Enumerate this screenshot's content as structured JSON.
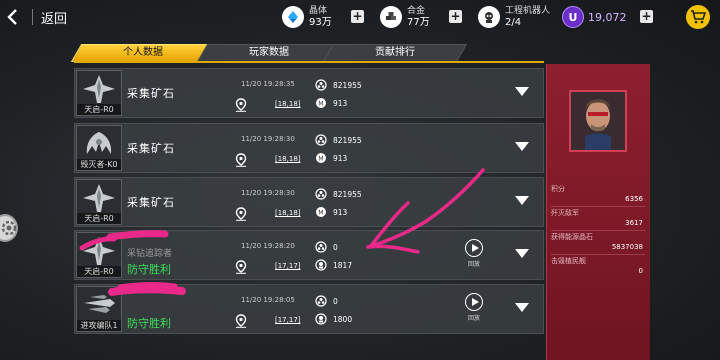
{
  "topbar": {
    "back_label": "返回",
    "crystal": {
      "name": "晶体",
      "value": "93万",
      "icon": "crystal-icon",
      "color": "#2aa8ff"
    },
    "alloy": {
      "name": "合金",
      "value": "77万",
      "icon": "alloy-icon"
    },
    "robots": {
      "name": "工程机器人",
      "value": "2/4",
      "icon": "robot-icon"
    },
    "premium": {
      "value": "19,072",
      "icon": "u-currency-icon",
      "color": "#a66cff"
    },
    "cart_icon": "shopping-cart-icon"
  },
  "tabs": [
    {
      "label": "个人数据",
      "active": true
    },
    {
      "label": "玩家数据",
      "active": false
    },
    {
      "label": "贡献排行",
      "active": false
    }
  ],
  "rows": [
    {
      "ship": "天启-R0",
      "title": "采集矿石",
      "time": "11/20 19:28:35",
      "coord": "[18,18]",
      "stat1": "821955",
      "stat2": "913"
    },
    {
      "ship": "毁灭者-K0",
      "title": "采集矿石",
      "time": "11/20 19:28:30",
      "coord": "[18,18]",
      "stat1": "821955",
      "stat2": "913"
    },
    {
      "ship": "天启-R0",
      "title": "采集矿石",
      "time": "11/20 19:28:30",
      "coord": "[18,18]",
      "stat1": "821955",
      "stat2": "913"
    },
    {
      "ship": "天启-R0",
      "subtitle": "采钻追踪者",
      "result": "防守胜利",
      "time": "11/20 19:28:20",
      "coord": "[17,17]",
      "stat1": "0",
      "stat2": "1817",
      "replay_label": "回放"
    },
    {
      "ship": "进攻编队1",
      "result": "防守胜利",
      "time": "11/20 19:28:05",
      "coord": "[17,17]",
      "stat1": "0",
      "stat2": "1800",
      "replay_label": "回放"
    }
  ],
  "panel": {
    "stats": [
      {
        "label": "积分",
        "value": "6356"
      },
      {
        "label": "歼灭敌军",
        "value": "3617"
      },
      {
        "label": "获得能源晶石",
        "value": "5837038"
      },
      {
        "label": "击毁植民舰",
        "value": "0"
      }
    ],
    "accent": "#8e1f2e"
  }
}
